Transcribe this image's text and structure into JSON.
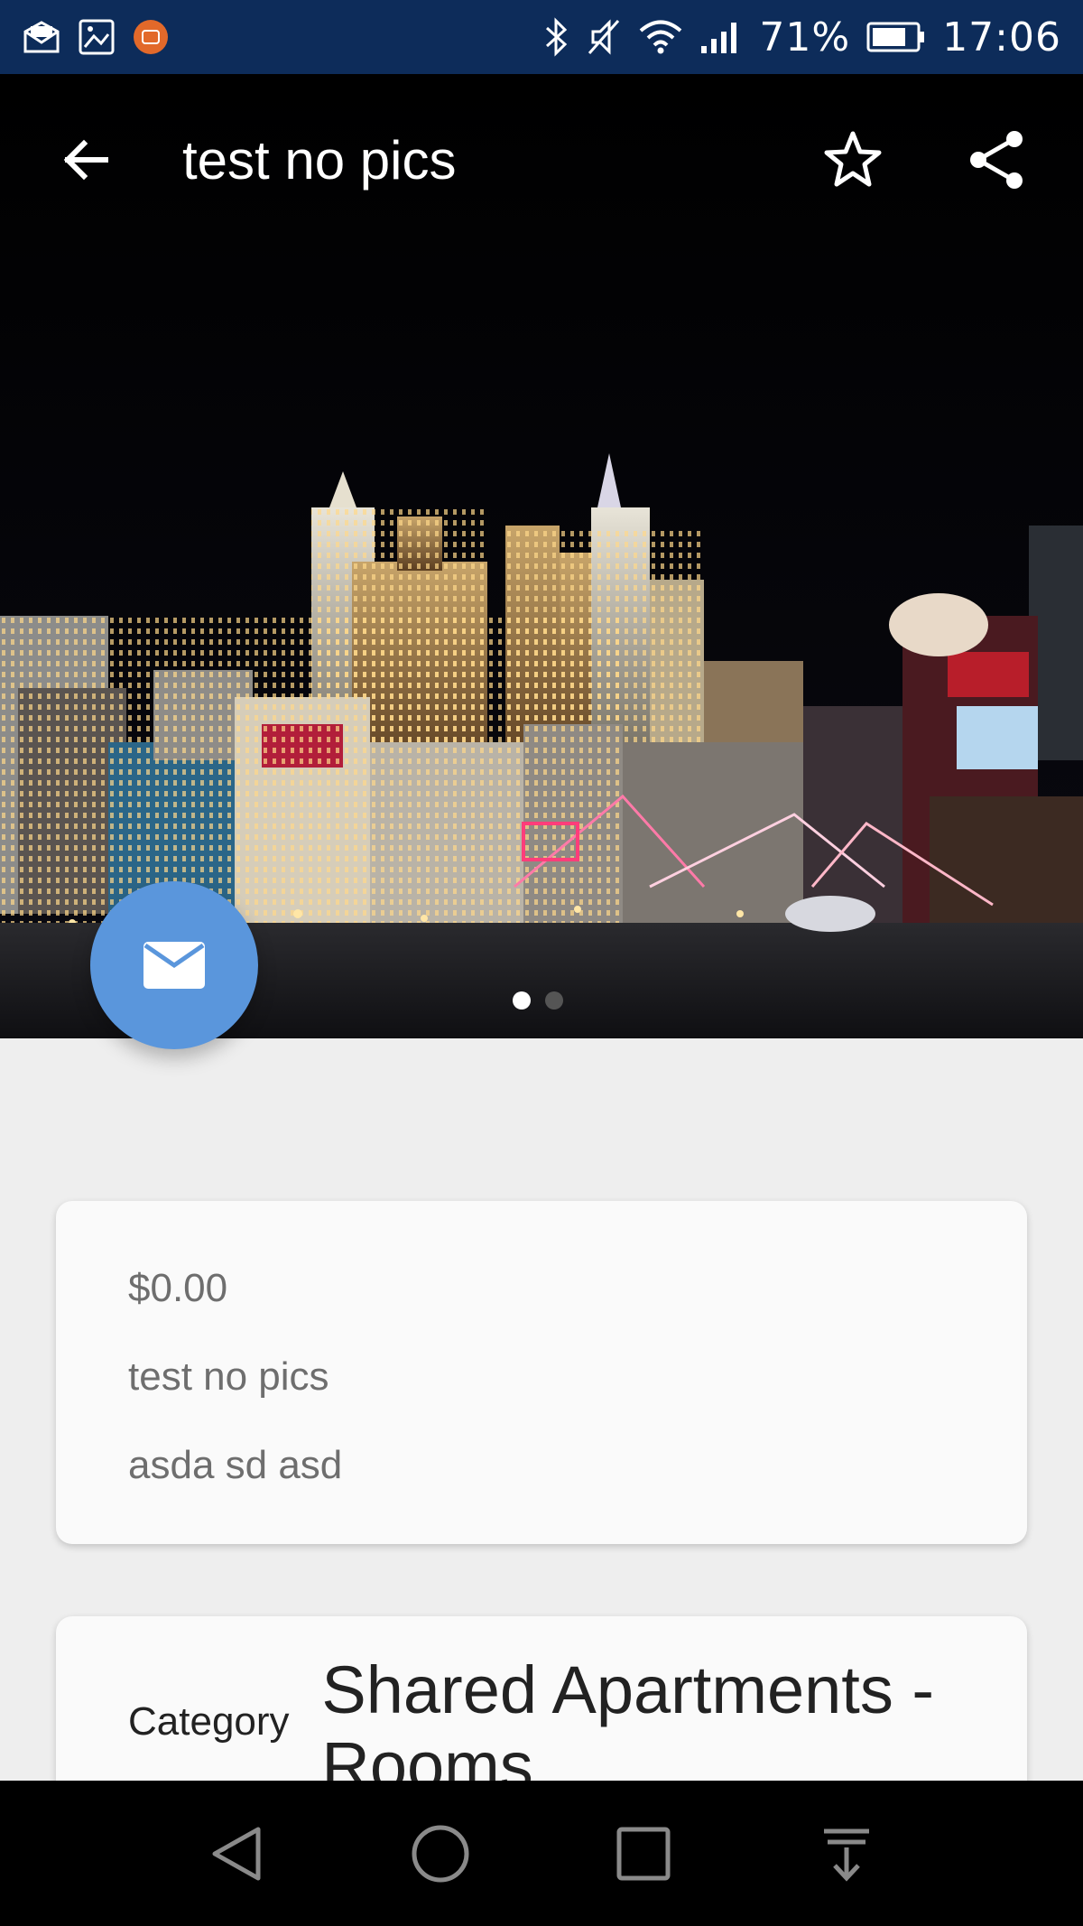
{
  "status_bar": {
    "battery_percent": "71%",
    "time": "17:06",
    "icons": [
      "mail-notification-icon",
      "image-notification-icon",
      "mi-app-icon",
      "bluetooth-icon",
      "vibrate-off-icon",
      "wifi-icon",
      "signal-icon",
      "battery-icon"
    ]
  },
  "toolbar": {
    "title": "test no pics",
    "icons": [
      "back-arrow-icon",
      "star-outline-icon",
      "share-icon"
    ]
  },
  "carousel": {
    "page_count": 2,
    "current_page": 1
  },
  "fab": {
    "icon": "mail-icon",
    "color": "#5a96dc"
  },
  "listing": {
    "price": "$0.00",
    "title": "test no pics",
    "description": "asda sd asd"
  },
  "details": {
    "category_label": "Category",
    "category_value": "Shared Apartments - Rooms"
  },
  "nav_bar": {
    "icons": [
      "nav-back-icon",
      "nav-home-icon",
      "nav-recents-icon",
      "nav-notifications-icon"
    ]
  },
  "colors": {
    "status_bar": "#0d2c5a",
    "background": "#eeeeee",
    "card": "#fafafa",
    "accent": "#5a96dc"
  }
}
